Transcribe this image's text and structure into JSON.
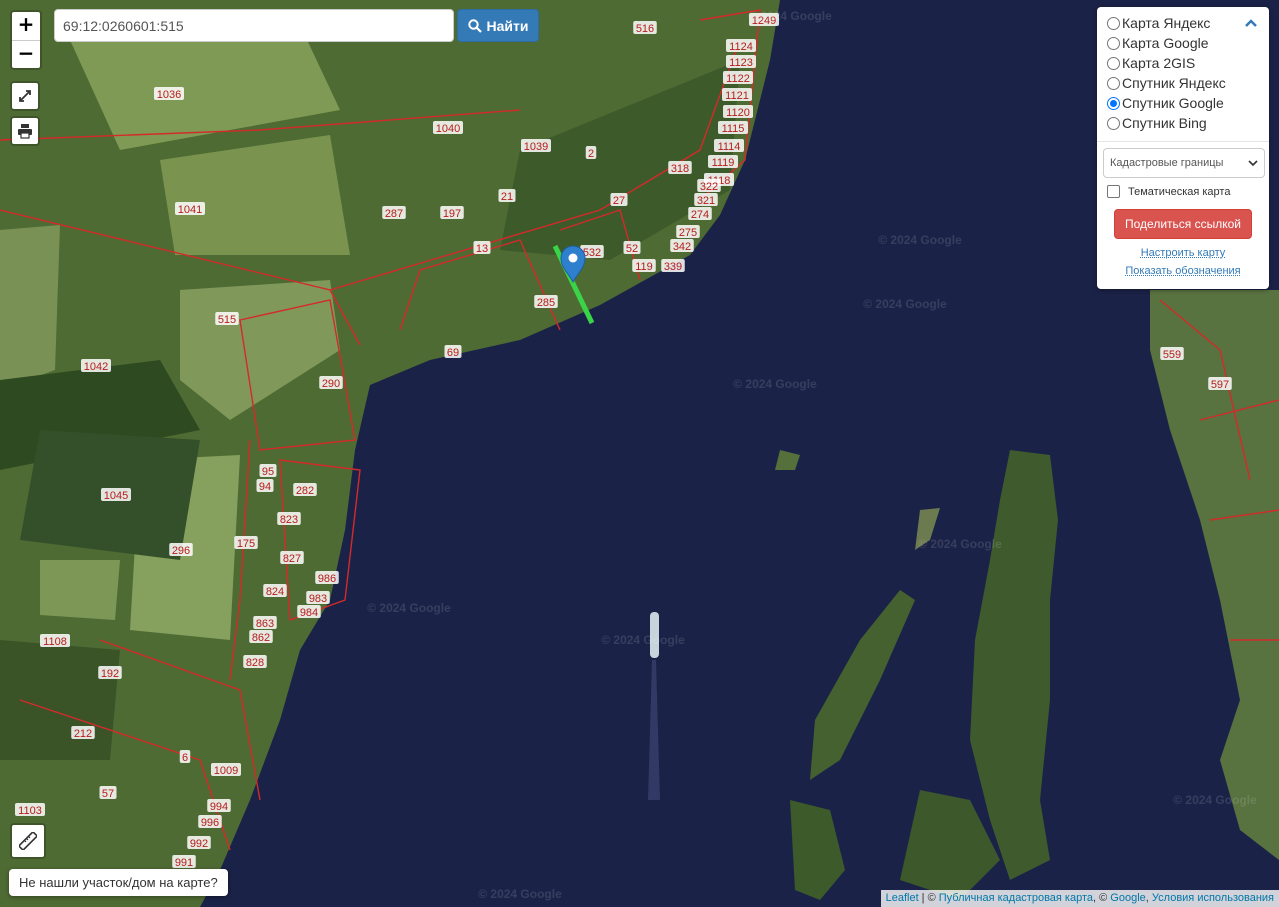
{
  "search": {
    "value": "69:12:0260601:515"
  },
  "find_button": {
    "label": "Найти"
  },
  "zoom": {
    "in_label": "+",
    "out_label": "−"
  },
  "layers": [
    {
      "label": "Карта Яндекс",
      "selected": false
    },
    {
      "label": "Карта Google",
      "selected": false
    },
    {
      "label": "Карта 2GIS",
      "selected": false
    },
    {
      "label": "Спутник Яндекс",
      "selected": false
    },
    {
      "label": "Спутник Google",
      "selected": true
    },
    {
      "label": "Спутник Bing",
      "selected": false
    }
  ],
  "overlay_select": {
    "value": "Кадастровые границы"
  },
  "thematic": {
    "label": "Тематическая карта",
    "checked": false
  },
  "share_button": {
    "label": "Поделиться ссылкой"
  },
  "links": {
    "configure": "Настроить карту",
    "legend": "Показать обозначения"
  },
  "not_found": {
    "label": "Не нашли участок/дом на карте?"
  },
  "attribution": {
    "leaflet": "Leaflet",
    "sep": " | © ",
    "kadastr": "Публичная кадастровая карта",
    "mid": ", © ",
    "google": "Google",
    "comma": ", ",
    "terms": "Условия использования"
  },
  "watermark": "© 2024 Google",
  "parcel_labels": [
    "1036",
    "1040",
    "1039",
    "516",
    "1249",
    "1124",
    "1123",
    "1122",
    "1121",
    "1120",
    "1115",
    "1114",
    "1119",
    "1118",
    "322",
    "321",
    "318",
    "274",
    "275",
    "342",
    "339",
    "1041",
    "287",
    "197",
    "21",
    "27",
    "2",
    "13",
    "532",
    "52",
    "119",
    "285",
    "69",
    "515",
    "1042",
    "290",
    "95",
    "94",
    "282",
    "1045",
    "296",
    "175",
    "823",
    "827",
    "986",
    "824",
    "983",
    "984",
    "863",
    "862",
    "828",
    "1108",
    "192",
    "212",
    "6",
    "1009",
    "57",
    "994",
    "996",
    "992",
    "991",
    "1103",
    "559",
    "597"
  ],
  "colors": {
    "water": "#1b2247",
    "parcel_line": "#d42a2a",
    "selected_parcel": "#39d447",
    "marker": "#2f7fcf",
    "field": "#6f8a4a",
    "forest": "#2f4a22"
  }
}
